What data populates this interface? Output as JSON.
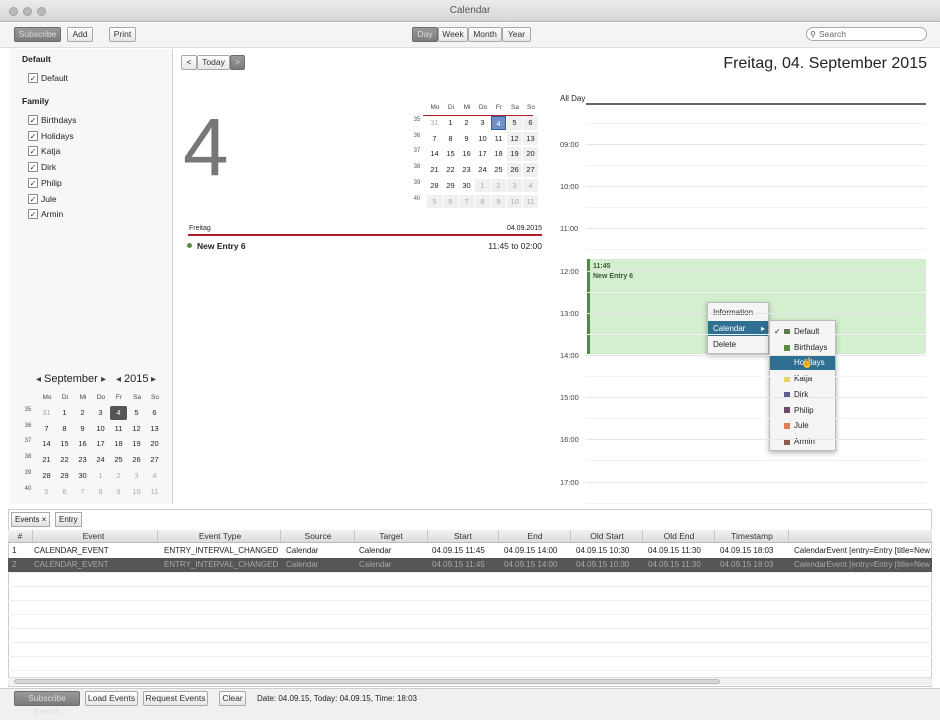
{
  "window": {
    "title": "Calendar"
  },
  "toolbar": {
    "btn1": "Subscribe",
    "add": "Add",
    "print": "Print",
    "views": [
      "Day",
      "Week",
      "Month",
      "Year"
    ],
    "search_placeholder": "Search"
  },
  "sidebar": {
    "groups": [
      {
        "name": "Default",
        "cals": [
          "Default"
        ]
      },
      {
        "name": "Family",
        "cals": [
          "Birthdays",
          "Holidays",
          "Katja",
          "Dirk",
          "Philip",
          "Jule",
          "Armin"
        ]
      }
    ],
    "minical": {
      "month": "September",
      "year": "2015",
      "days": [
        "Mo",
        "Di",
        "Mi",
        "Do",
        "Fr",
        "Sa",
        "So"
      ],
      "weeks": [
        [
          "35",
          "31",
          "1",
          "2",
          "3",
          "4",
          "5",
          "6"
        ],
        [
          "36",
          "7",
          "8",
          "9",
          "10",
          "11",
          "12",
          "13"
        ],
        [
          "37",
          "14",
          "15",
          "16",
          "17",
          "18",
          "19",
          "20"
        ],
        [
          "38",
          "21",
          "22",
          "23",
          "24",
          "25",
          "26",
          "27"
        ],
        [
          "39",
          "28",
          "29",
          "30",
          "1",
          "2",
          "3",
          "4"
        ],
        [
          "40",
          "5",
          "6",
          "7",
          "8",
          "9",
          "10",
          "11"
        ]
      ]
    }
  },
  "main": {
    "nav": {
      "prev": "<",
      "today": "Today",
      "next": ">"
    },
    "big_day": "4",
    "title": "Freitag, 04. September 2015",
    "agenda_day": "Freitag",
    "agenda_date": "04.09.2015",
    "entry": {
      "name": "New Entry 6",
      "time": "11:45 to 02:00"
    },
    "allday": "All Day",
    "hours": [
      "09:00",
      "10:00",
      "11:00",
      "12:00",
      "13:00",
      "14:00",
      "15:00",
      "16:00",
      "17:00"
    ],
    "event": {
      "time": "11:45",
      "title": "New Entry 6"
    }
  },
  "context_menu": {
    "items": [
      "Information",
      "Calendar",
      "Delete"
    ],
    "submenu": [
      {
        "name": "Default",
        "color": "#5a7a4a",
        "checked": true
      },
      {
        "name": "Birthdays",
        "color": "#5c8a3e"
      },
      {
        "name": "Holidays",
        "color": "#2f6f91"
      },
      {
        "name": "Katja",
        "color": "#e5d46a"
      },
      {
        "name": "Dirk",
        "color": "#5f5f8e"
      },
      {
        "name": "Philip",
        "color": "#6b4a6b"
      },
      {
        "name": "Jule",
        "color": "#d98054"
      },
      {
        "name": "Armin",
        "color": "#8a5a4a"
      }
    ]
  },
  "bottom": {
    "tabs": [
      "Events ×",
      "Entry"
    ],
    "headers": [
      "#",
      "Event",
      "Event Type",
      "Source",
      "Target",
      "Start",
      "End",
      "Old Start",
      "Old End",
      "Timestamp"
    ],
    "rows": [
      [
        "1",
        "CALENDAR_EVENT",
        "ENTRY_INTERVAL_CHANGED",
        "Calendar",
        "Calendar",
        "04.09.15 11:45",
        "04.09.15 14:00",
        "04.09.15 10:30",
        "04.09.15 11:30",
        "04.09.15 18:03",
        "CalendarEvent [entry=Entry [title=New E"
      ],
      [
        "2",
        "CALENDAR_EVENT",
        "ENTRY_INTERVAL_CHANGED",
        "Calendar",
        "Calendar",
        "04.09.15 11:45",
        "04.09.15 14:00",
        "04.09.15 10:30",
        "04.09.15 11:30",
        "04.09.15 18:03",
        "CalendarEvent [entry=Entry [title=New E"
      ]
    ]
  },
  "status": {
    "b1": "Subscribe Events",
    "b2": "Load Events",
    "b3": "Request Events",
    "b4": "Clear",
    "text": "Date: 04.09.15, Today: 04.09.15, Time: 18:03"
  }
}
